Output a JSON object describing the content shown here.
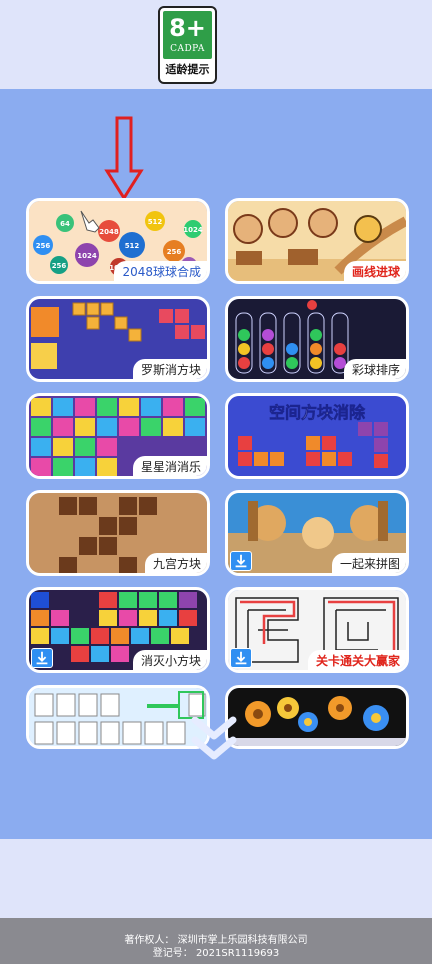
{
  "age_badge": {
    "rating": "8+",
    "org": "CADPA",
    "tip": "适龄提示"
  },
  "games": [
    {
      "label": "2048球球合成"
    },
    {
      "label": "画线进球"
    },
    {
      "label": "罗斯消方块"
    },
    {
      "label": "彩球排序"
    },
    {
      "label": "星星消消乐"
    },
    {
      "label": "空间方块消除"
    },
    {
      "label": "九宫方块"
    },
    {
      "label": "一起来拼图"
    },
    {
      "label": "消灭小方块"
    },
    {
      "label": "关卡通关大赢家"
    }
  ],
  "ball_numbers": [
    "512",
    "256",
    "64",
    "256",
    "512",
    "1024",
    "2048",
    "1024",
    "256",
    "1024",
    "64"
  ],
  "footer": {
    "copyright": "著作权人：  深圳市掌上乐园科技有限公司",
    "registration": "登记号：  2021SR1119693"
  },
  "colors": {
    "panel": "#8bacf0",
    "background": "#dfe4fa",
    "arrow": "#e02020",
    "badge_green": "#2f9e48",
    "footer": "#8a8a90"
  },
  "icons": [
    "down-arrow-indicator",
    "hand-pointer-icon",
    "download-icon",
    "double-chevron-down-icon"
  ]
}
